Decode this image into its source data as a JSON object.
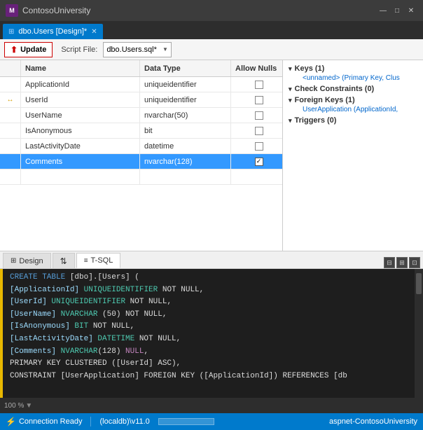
{
  "titleBar": {
    "appName": "ContosoUniversity",
    "appIconLabel": "VS",
    "minimizeBtn": "—",
    "restoreBtn": "□",
    "closeBtn": "✕"
  },
  "tabBar": {
    "tabLabel": "dbo.Users [Design]*",
    "tabClose": "✕"
  },
  "toolbar": {
    "updateBtn": "Update",
    "scriptFileLabel": "Script File:",
    "scriptFileValue": "dbo.Users.sql*"
  },
  "grid": {
    "columns": [
      "",
      "Name",
      "Data Type",
      "Allow Nulls"
    ],
    "rows": [
      {
        "icon": "",
        "name": "ApplicationId",
        "type": "uniqueidentifier",
        "allowNull": false,
        "selected": false,
        "hasKey": false
      },
      {
        "icon": "↔",
        "name": "UserId",
        "type": "uniqueidentifier",
        "allowNull": false,
        "selected": false,
        "hasKey": false
      },
      {
        "icon": "",
        "name": "UserName",
        "type": "nvarchar(50)",
        "allowNull": false,
        "selected": false,
        "hasKey": false
      },
      {
        "icon": "",
        "name": "IsAnonymous",
        "type": "bit",
        "allowNull": false,
        "selected": false,
        "hasKey": false
      },
      {
        "icon": "",
        "name": "LastActivityDate",
        "type": "datetime",
        "allowNull": false,
        "selected": false,
        "hasKey": false
      },
      {
        "icon": "",
        "name": "Comments",
        "type": "nvarchar(128)",
        "allowNull": true,
        "selected": true,
        "hasKey": false
      },
      {
        "icon": "",
        "name": "",
        "type": "",
        "allowNull": false,
        "selected": false,
        "hasKey": false
      }
    ]
  },
  "properties": {
    "sections": [
      {
        "label": "Keys (1)",
        "items": [
          "<unnamed>   (Primary Key, Clus"
        ]
      },
      {
        "label": "Check Constraints (0)",
        "items": []
      },
      {
        "label": "Foreign Keys (1)",
        "items": [
          "UserApplication  (ApplicationId,"
        ]
      },
      {
        "label": "Triggers (0)",
        "items": []
      }
    ]
  },
  "bottomTabs": [
    {
      "label": "Design",
      "icon": "⊞",
      "active": false
    },
    {
      "label": "↕",
      "icon": "",
      "active": false
    },
    {
      "label": "T-SQL",
      "icon": "≡",
      "active": true
    }
  ],
  "sqlEditor": {
    "lines": [
      {
        "tokens": [
          {
            "text": "CREATE",
            "class": "sql-kw"
          },
          {
            "text": " TABLE ",
            "class": "sql-kw"
          },
          {
            "text": "[dbo].[Users] (",
            "class": "sql-punc"
          }
        ]
      },
      {
        "tokens": [
          {
            "text": "    [ApplicationId]   ",
            "class": "sql-id"
          },
          {
            "text": "UNIQUEIDENTIFIER",
            "class": "sql-type"
          },
          {
            "text": " NOT NULL,",
            "class": "sql-punc"
          }
        ]
      },
      {
        "tokens": [
          {
            "text": "    [UserId]         ",
            "class": "sql-id"
          },
          {
            "text": "UNIQUEIDENTIFIER",
            "class": "sql-type"
          },
          {
            "text": " NOT NULL,",
            "class": "sql-punc"
          }
        ]
      },
      {
        "tokens": [
          {
            "text": "    [UserName]       ",
            "class": "sql-id"
          },
          {
            "text": "NVARCHAR",
            "class": "sql-type"
          },
          {
            "text": " (50)    NOT NULL,",
            "class": "sql-punc"
          }
        ]
      },
      {
        "tokens": [
          {
            "text": "    [IsAnonymous]    ",
            "class": "sql-id"
          },
          {
            "text": "BIT",
            "class": "sql-type"
          },
          {
            "text": "              NOT NULL,",
            "class": "sql-punc"
          }
        ]
      },
      {
        "tokens": [
          {
            "text": "    [LastActivityDate] ",
            "class": "sql-id"
          },
          {
            "text": "DATETIME",
            "class": "sql-type"
          },
          {
            "text": "         NOT NULL,",
            "class": "sql-punc"
          }
        ]
      },
      {
        "tokens": [
          {
            "text": "    [Comments] ",
            "class": "sql-id"
          },
          {
            "text": "NVARCHAR",
            "class": "sql-type"
          },
          {
            "text": "(128) ",
            "class": "sql-punc"
          },
          {
            "text": "NULL",
            "class": "sql-null"
          },
          {
            "text": ",",
            "class": "sql-punc"
          }
        ]
      },
      {
        "tokens": [
          {
            "text": "    PRIMARY KEY CLUSTERED ([UserId] ASC),",
            "class": "sql-punc"
          }
        ]
      },
      {
        "tokens": [
          {
            "text": "    CONSTRAINT [UserApplication] FOREIGN KEY ([ApplicationId]) REFERENCES [db",
            "class": "sql-punc"
          }
        ]
      }
    ]
  },
  "statusBar": {
    "connectionIcon": "⚡",
    "connectionText": "Connection Ready",
    "serverText": "(localdb)\\v11.0",
    "dbText": "aspnet-ContosoUniversity",
    "zoomLabel": "100 %"
  }
}
